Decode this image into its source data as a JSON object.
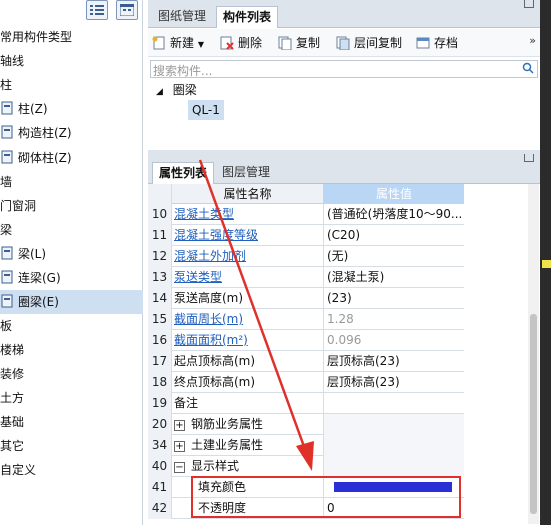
{
  "left_panel": {
    "items": [
      {
        "label": "常用构件类型",
        "icon": "none"
      },
      {
        "label": "轴线",
        "icon": "none"
      },
      {
        "label": "柱",
        "icon": "none"
      },
      {
        "label": "柱(Z)",
        "icon": "column-icon"
      },
      {
        "label": "构造柱(Z)",
        "icon": "construct-column-icon"
      },
      {
        "label": "砌体柱(Z)",
        "icon": "masonry-column-icon"
      },
      {
        "label": "墙",
        "icon": "none"
      },
      {
        "label": "门窗洞",
        "icon": "none"
      },
      {
        "label": "梁",
        "icon": "none"
      },
      {
        "label": "梁(L)",
        "icon": "beam-icon"
      },
      {
        "label": "连梁(G)",
        "icon": "link-beam-icon"
      },
      {
        "label": "圈梁(E)",
        "icon": "ring-beam-icon",
        "selected": true
      },
      {
        "label": "板",
        "icon": "none"
      },
      {
        "label": "楼梯",
        "icon": "none"
      },
      {
        "label": "装修",
        "icon": "none"
      },
      {
        "label": "土方",
        "icon": "none"
      },
      {
        "label": "基础",
        "icon": "none"
      },
      {
        "label": "其它",
        "icon": "none"
      },
      {
        "label": "自定义",
        "icon": "none"
      }
    ]
  },
  "top_tabs": [
    "图纸管理",
    "构件列表"
  ],
  "toolbar": {
    "new_label": "新建",
    "delete_label": "删除",
    "copy_label": "复制",
    "floor_copy_label": "层间复制",
    "archive_label": "存档",
    "more": "»"
  },
  "search": {
    "placeholder": "搜索构件..."
  },
  "component_tree": {
    "group": "圈梁",
    "item": "QL-1"
  },
  "prop_tabs": [
    "属性列表",
    "图层管理"
  ],
  "grid": {
    "header_name": "属性名称",
    "header_value": "属性值",
    "rows": [
      {
        "num": "10",
        "name": "混凝土类型",
        "value": "(普通砼(坍落度10～90...",
        "style": "blue"
      },
      {
        "num": "11",
        "name": "混凝土强度等级",
        "value": "(C20)",
        "style": "blue"
      },
      {
        "num": "12",
        "name": "混凝土外加剂",
        "value": "(无)",
        "style": "blue"
      },
      {
        "num": "13",
        "name": "泵送类型",
        "value": "(混凝土泵)",
        "style": "blue"
      },
      {
        "num": "14",
        "name": "泵送高度(m)",
        "value": "(23)",
        "style": "normal"
      },
      {
        "num": "15",
        "name": "截面周长(m)",
        "value": "1.28",
        "style": "blue-gray"
      },
      {
        "num": "16",
        "name": "截面面积(m²)",
        "value": "0.096",
        "style": "blue-gray"
      },
      {
        "num": "17",
        "name": "起点顶标高(m)",
        "value": "层顶标高(23)",
        "style": "normal"
      },
      {
        "num": "18",
        "name": "终点顶标高(m)",
        "value": "层顶标高(23)",
        "style": "normal"
      },
      {
        "num": "19",
        "name": "备注",
        "value": "",
        "style": "normal"
      },
      {
        "num": "20",
        "name": "钢筋业务属性",
        "value": "",
        "style": "expand"
      },
      {
        "num": "34",
        "name": "土建业务属性",
        "value": "",
        "style": "expand"
      },
      {
        "num": "40",
        "name": "显示样式",
        "value": "",
        "style": "collapse"
      },
      {
        "num": "41",
        "name": "填充颜色",
        "value": "",
        "style": "color",
        "color": "#2a2fd6"
      },
      {
        "num": "42",
        "name": "不透明度",
        "value": "0",
        "style": "child"
      }
    ]
  },
  "annotation_color": "#e0302a"
}
